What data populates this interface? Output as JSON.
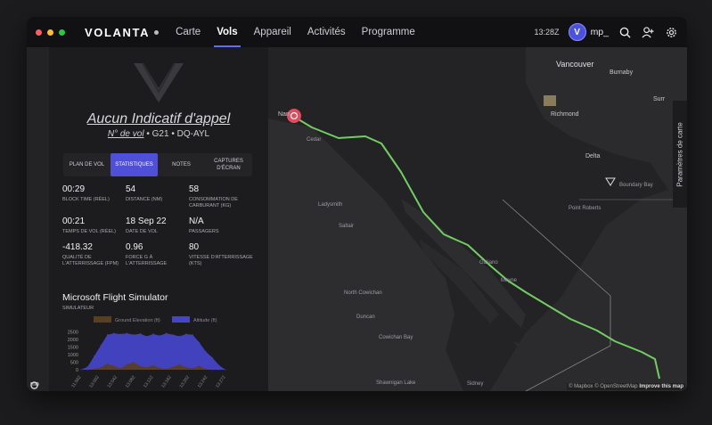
{
  "window_controls": {
    "close_color": "#ff5f57",
    "min_color": "#febc2e",
    "max_color": "#28c840"
  },
  "brand": {
    "name": "VOLANTA"
  },
  "nav": {
    "items": [
      "Carte",
      "Vols",
      "Appareil",
      "Activités",
      "Programme"
    ],
    "active": "Vols"
  },
  "header": {
    "clock": "13:28Z",
    "user": "mp_",
    "avatar_letter": "V",
    "icons": [
      "search-icon",
      "add-user-icon",
      "gear-icon"
    ]
  },
  "flight": {
    "callsign": "Aucun Indicatif d'appel",
    "flight_no_label": "N° de vol",
    "aircraft_type": "G21",
    "registration": "DQ-AYL",
    "separator": "•"
  },
  "tabs": [
    {
      "label": "PLAN DE VOL"
    },
    {
      "label": "STATISTIQUES"
    },
    {
      "label": "NOTES"
    },
    {
      "label": "CAPTURES D'ÉCRAN"
    }
  ],
  "stats": [
    {
      "value": "00:29",
      "label": "BLOCK TIME (RÉEL)"
    },
    {
      "value": "54",
      "label": "DISTANCE (NM)"
    },
    {
      "value": "58",
      "label": "CONSOMMATION DE CARBURANT (KG)"
    },
    {
      "value": "00:21",
      "label": "TEMPS DE VOL (RÉEL)"
    },
    {
      "value": "18 Sep 22",
      "label": "DATE DE VOL"
    },
    {
      "value": "N/A",
      "label": "PASSAGERS"
    },
    {
      "value": "-418.32",
      "label": "QUALITÉ DE L'ATTERRISSAGE (FPM)"
    },
    {
      "value": "0.96",
      "label": "FORCE G À L'ATTERRISSAGE"
    },
    {
      "value": "80",
      "label": "VITESSE D'ATTERRISSAGE (KTS)"
    }
  ],
  "simulator": {
    "name": "Microsoft Flight Simulator",
    "label": "SIMULATEUR"
  },
  "chart_data": {
    "type": "area",
    "series": [
      {
        "name": "Ground Elevation (ft)",
        "color": "#5a3f1e",
        "values": [
          0,
          0,
          50,
          150,
          400,
          250,
          100,
          350,
          500,
          250,
          150,
          300,
          100,
          50,
          200,
          350,
          150,
          100,
          250,
          50,
          0,
          0,
          0
        ]
      },
      {
        "name": "Altitude (ft)",
        "color": "#4545c8",
        "values": [
          0,
          200,
          900,
          1600,
          2300,
          2400,
          2350,
          2400,
          2300,
          2380,
          2200,
          2350,
          2250,
          2400,
          2300,
          2200,
          2350,
          2300,
          1800,
          1200,
          800,
          300,
          0
        ]
      }
    ],
    "y_ticks": [
      0,
      500,
      1000,
      1500,
      2000,
      2500
    ],
    "ylim": [
      0,
      2700
    ],
    "x_ticks": [
      "11:562",
      "13:002",
      "13:042",
      "13:082",
      "13:122",
      "13:162",
      "13:202",
      "13:242",
      "13:272"
    ],
    "grid": false,
    "legend": "top"
  },
  "map": {
    "settings_label": "Paramètres de carte",
    "attribution": "© Mapbox © OpenStreetMap",
    "improve": "Improve this map",
    "mapbox_logo": "mo",
    "route_color": "#6fcf5f",
    "places": {
      "vancouver": "Vancouver",
      "burnaby": "Burnaby",
      "richmond": "Richmond",
      "surrey": "Surr",
      "delta": "Delta",
      "boundary_bay": "Boundary Bay",
      "point_roberts": "Point Roberts",
      "nanaimo": "Nan",
      "cedar": "Cedar",
      "ladysmith": "Ladysmith",
      "saltair": "Saltair",
      "north_cowichan": "North Cowichan",
      "duncan": "Duncan",
      "cowichan_bay": "Cowichan Bay",
      "shawnigan_lake": "Shawnigan Lake",
      "sidney": "Sidney",
      "galiano": "Galiano",
      "mayne": "Mayne"
    }
  }
}
